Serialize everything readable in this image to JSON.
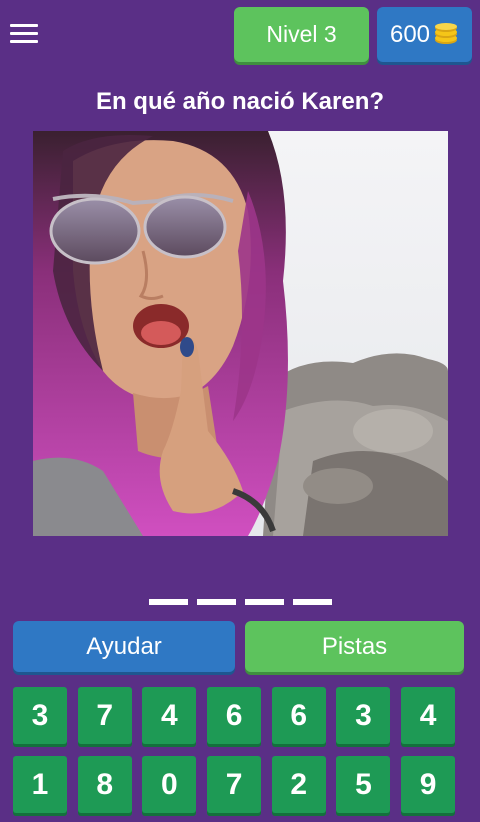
{
  "header": {
    "menu_icon": "hamburger-menu-icon",
    "level_label": "Nivel 3",
    "coins_value": "600",
    "coins_icon": "coin-stack-icon"
  },
  "question": {
    "text": "En qué año nació Karen?"
  },
  "photo": {
    "subject": "woman with pink-purple hair and mirrored sunglasses beside rocks"
  },
  "answer": {
    "slots": [
      "",
      "",
      "",
      ""
    ]
  },
  "buttons": {
    "help_label": "Ayudar",
    "hints_label": "Pistas"
  },
  "keypad": {
    "digits": [
      "3",
      "7",
      "4",
      "6",
      "6",
      "3",
      "4",
      "1",
      "8",
      "0",
      "7",
      "2",
      "5",
      "9"
    ]
  },
  "colors": {
    "background": "#5a2f86",
    "green": "#5dc35d",
    "blue": "#2f78c4",
    "digit_green": "#1e9a55",
    "coin_gold": "#f5c518"
  }
}
